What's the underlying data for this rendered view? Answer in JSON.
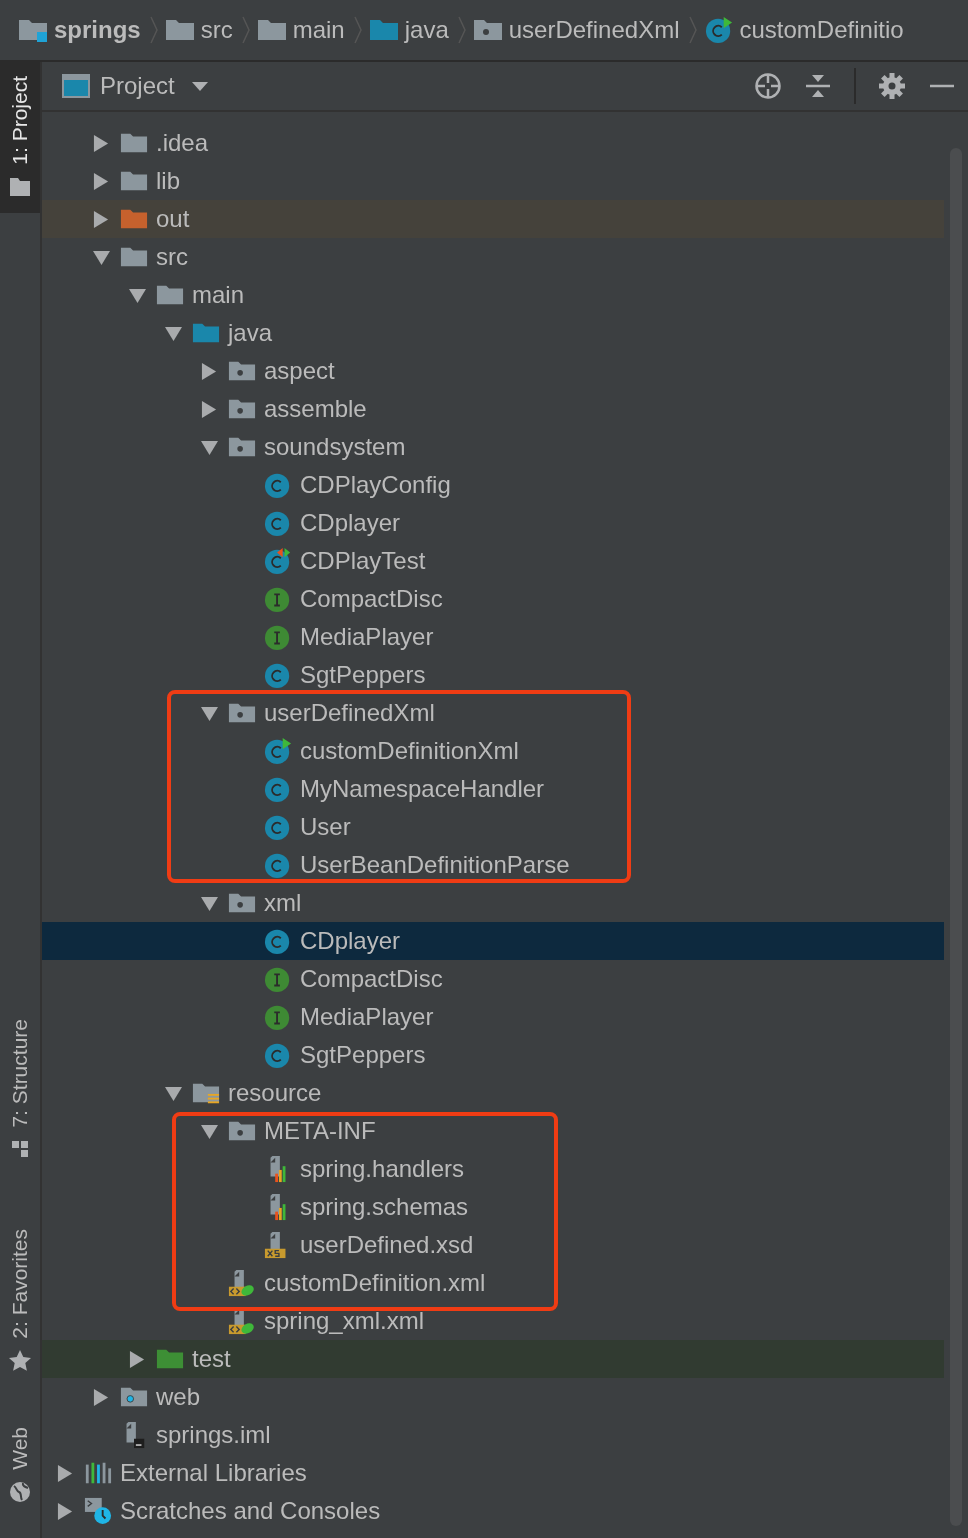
{
  "breadcrumb": [
    {
      "label": "springs",
      "kind": "module"
    },
    {
      "label": "src",
      "kind": "folder"
    },
    {
      "label": "main",
      "kind": "folder"
    },
    {
      "label": "java",
      "kind": "source-folder"
    },
    {
      "label": "userDefinedXml",
      "kind": "package"
    },
    {
      "label": "customDefinitio",
      "kind": "main-class"
    }
  ],
  "side_tabs": [
    {
      "label": "1: Project",
      "kind": "project",
      "selected": true
    },
    {
      "label": "7: Structure",
      "kind": "structure",
      "selected": false
    },
    {
      "label": "2: Favorites",
      "kind": "favorites",
      "selected": false
    },
    {
      "label": "Web",
      "kind": "web",
      "selected": false
    }
  ],
  "panel": {
    "title": "Project"
  },
  "tree": {
    "module_children": [
      {
        "label": ".idea",
        "kind": "folder",
        "expanded": false,
        "selected": false
      },
      {
        "label": "lib",
        "kind": "folder",
        "expanded": false,
        "selected": false
      },
      {
        "label": "out",
        "kind": "excluded-folder",
        "expanded": false,
        "selected": false
      },
      {
        "label": "src",
        "kind": "folder",
        "expanded": true,
        "selected": false,
        "children": [
          {
            "label": "main",
            "kind": "folder",
            "expanded": true,
            "selected": false,
            "children": [
              {
                "label": "java",
                "kind": "source-folder",
                "expanded": true,
                "selected": false,
                "children": [
                  {
                    "label": "aspect",
                    "kind": "package",
                    "expanded": false,
                    "selected": false
                  },
                  {
                    "label": "assemble",
                    "kind": "package",
                    "expanded": false,
                    "selected": false
                  },
                  {
                    "label": "soundsystem",
                    "kind": "package",
                    "expanded": true,
                    "selected": false,
                    "children": [
                      {
                        "label": "CDPlayConfig",
                        "kind": "class",
                        "selected": false
                      },
                      {
                        "label": "CDplayer",
                        "kind": "class",
                        "selected": false
                      },
                      {
                        "label": "CDPlayTest",
                        "kind": "test-class",
                        "selected": false
                      },
                      {
                        "label": "CompactDisc",
                        "kind": "interface",
                        "selected": false
                      },
                      {
                        "label": "MediaPlayer",
                        "kind": "interface",
                        "selected": false
                      },
                      {
                        "label": "SgtPeppers",
                        "kind": "class",
                        "selected": false
                      }
                    ]
                  },
                  {
                    "label": "userDefinedXml",
                    "kind": "package",
                    "expanded": true,
                    "selected": false,
                    "children": [
                      {
                        "label": "customDefinitionXml",
                        "kind": "main-class",
                        "selected": false
                      },
                      {
                        "label": "MyNamespaceHandler",
                        "kind": "class",
                        "selected": false
                      },
                      {
                        "label": "User",
                        "kind": "class",
                        "selected": false
                      },
                      {
                        "label": "UserBeanDefinitionParse",
                        "kind": "class",
                        "selected": false
                      }
                    ]
                  },
                  {
                    "label": "xml",
                    "kind": "package",
                    "expanded": true,
                    "selected": false,
                    "children": [
                      {
                        "label": "CDplayer",
                        "kind": "class",
                        "selected": true
                      },
                      {
                        "label": "CompactDisc",
                        "kind": "interface",
                        "selected": false
                      },
                      {
                        "label": "MediaPlayer",
                        "kind": "interface",
                        "selected": false
                      },
                      {
                        "label": "SgtPeppers",
                        "kind": "class",
                        "selected": false
                      }
                    ]
                  }
                ]
              },
              {
                "label": "resource",
                "kind": "resource-folder",
                "expanded": true,
                "selected": false,
                "children": [
                  {
                    "label": "META-INF",
                    "kind": "package",
                    "expanded": true,
                    "selected": false,
                    "children": [
                      {
                        "label": "spring.handlers",
                        "kind": "properties",
                        "selected": false
                      },
                      {
                        "label": "spring.schemas",
                        "kind": "properties",
                        "selected": false
                      },
                      {
                        "label": "userDefined.xsd",
                        "kind": "xsd",
                        "selected": false
                      }
                    ]
                  },
                  {
                    "label": "customDefinition.xml",
                    "kind": "spring-xml",
                    "selected": false
                  },
                  {
                    "label": "spring_xml.xml",
                    "kind": "spring-xml",
                    "selected": false
                  }
                ]
              }
            ]
          },
          {
            "label": "test",
            "kind": "test-folder",
            "expanded": false,
            "selected": false
          }
        ]
      },
      {
        "label": "web",
        "kind": "web-folder",
        "expanded": false,
        "selected": false
      },
      {
        "label": "springs.iml",
        "kind": "iml",
        "selected": false
      }
    ],
    "roots": [
      {
        "label": "External Libraries",
        "kind": "libraries",
        "expanded": false,
        "selected": false
      },
      {
        "label": "Scratches and Consoles",
        "kind": "scratches",
        "expanded": false,
        "selected": false
      }
    ]
  }
}
